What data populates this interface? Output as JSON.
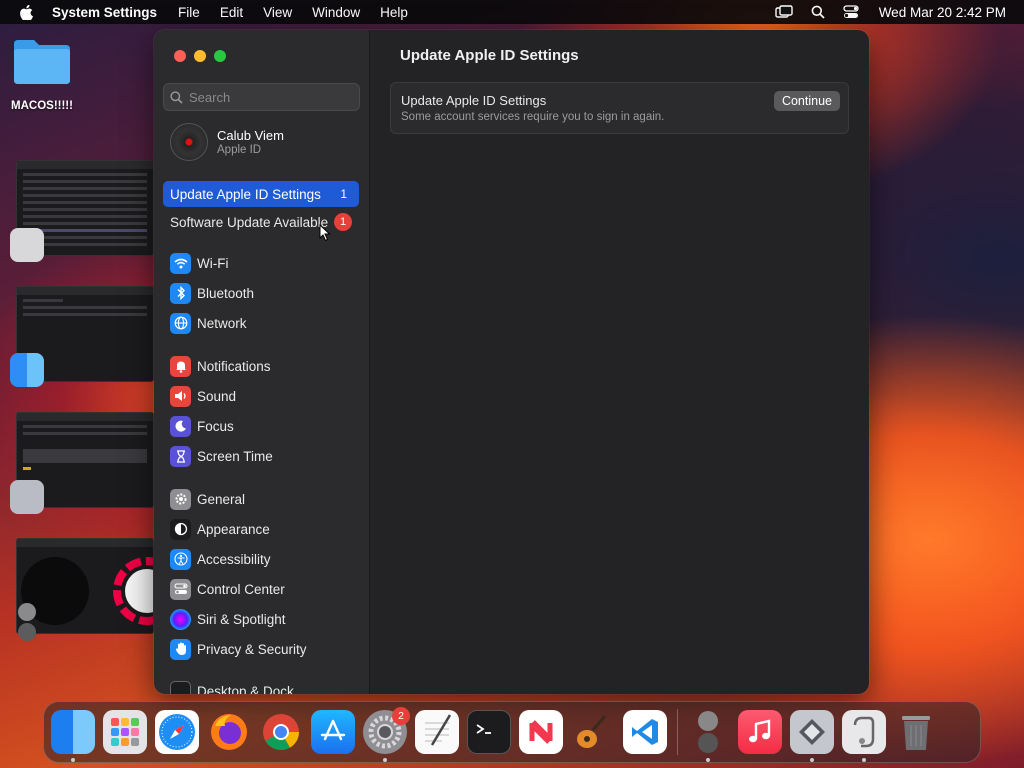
{
  "menubar": {
    "app_name": "System Settings",
    "items": [
      "File",
      "Edit",
      "View",
      "Window",
      "Help"
    ],
    "clock": "Wed Mar 20  2:42 PM"
  },
  "desktop": {
    "folder_label": "MACOS!!!!!"
  },
  "window": {
    "search_placeholder": "Search",
    "account": {
      "name": "Calub Viem",
      "subtitle": "Apple ID"
    },
    "top_items": [
      {
        "label": "Update Apple ID Settings",
        "badge": "1"
      },
      {
        "label": "Software Update Available",
        "badge": "1"
      }
    ],
    "sidebar_items": [
      {
        "label": "Wi-Fi",
        "icon": "wifi-icon",
        "color": "#1e88f5"
      },
      {
        "label": "Bluetooth",
        "icon": "bluetooth-icon",
        "color": "#1e88f5"
      },
      {
        "label": "Network",
        "icon": "globe-icon",
        "color": "#1e88f5"
      },
      {
        "label": "Notifications",
        "icon": "bell-icon",
        "color": "#e8453c"
      },
      {
        "label": "Sound",
        "icon": "speaker-icon",
        "color": "#e8453c"
      },
      {
        "label": "Focus",
        "icon": "moon-icon",
        "color": "#5a52d6"
      },
      {
        "label": "Screen Time",
        "icon": "hourglass-icon",
        "color": "#5a52d6"
      },
      {
        "label": "General",
        "icon": "gear-icon",
        "color": "#8e8e93"
      },
      {
        "label": "Appearance",
        "icon": "appearance-icon",
        "color": "#1c1c1e"
      },
      {
        "label": "Accessibility",
        "icon": "accessibility-icon",
        "color": "#1e88f5"
      },
      {
        "label": "Control Center",
        "icon": "switches-icon",
        "color": "#8e8e93"
      },
      {
        "label": "Siri & Spotlight",
        "icon": "siri-icon",
        "color": "#7b3fe4"
      },
      {
        "label": "Privacy & Security",
        "icon": "hand-icon",
        "color": "#1e88f5"
      },
      {
        "label": "Desktop & Dock",
        "icon": "dock-icon",
        "color": "#1c1c1e"
      }
    ],
    "main": {
      "title": "Update Apple ID Settings",
      "card_title": "Update Apple ID Settings",
      "card_desc": "Some account services require you to sign in again.",
      "button": "Continue"
    }
  },
  "dock": {
    "system_settings_badge": "2"
  },
  "colors": {
    "accent": "#1f5bd6",
    "badge_red": "#e5403a",
    "close": "#fe5f57",
    "minimize": "#febc2e",
    "zoom": "#28c840"
  }
}
